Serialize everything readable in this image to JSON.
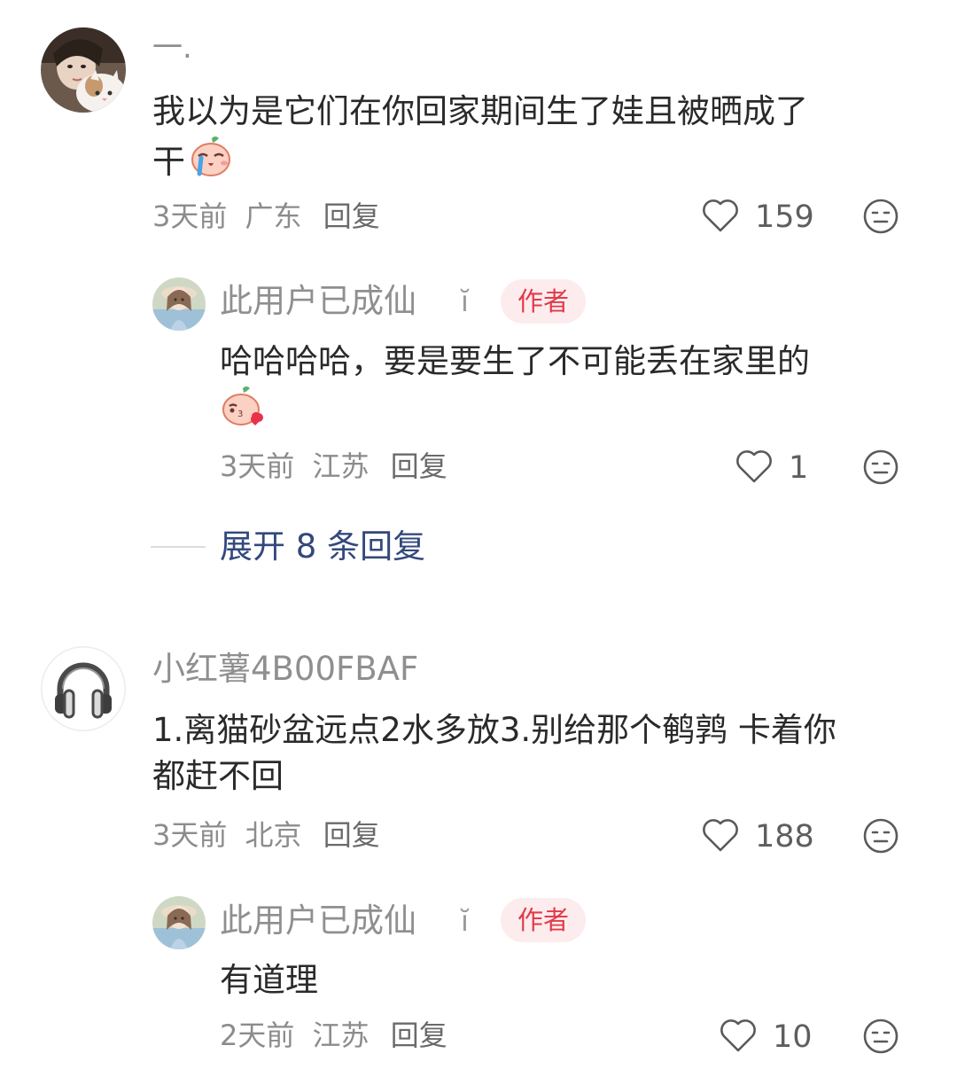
{
  "comments": [
    {
      "username": "一.",
      "text_line1": "我以为是它们在你回家期间生了娃且被晒成了",
      "text_line2": "干",
      "time": "3天前",
      "location": "广东",
      "reply_label": "回复",
      "likes": "159",
      "reply": {
        "username": "此用户已成仙",
        "level_mark": "ĭ",
        "badge": "作者",
        "text_line1": "哈哈哈哈，要是要生了不可能丢在家里的",
        "time": "3天前",
        "location": "江苏",
        "reply_label": "回复",
        "likes": "1"
      },
      "expand_label": "展开 8 条回复"
    },
    {
      "username": "小红薯4B00FBAF",
      "text_line1": "1.离猫砂盆远点2水多放3.别给那个鹌鹑 卡着你",
      "text_line2": "都赶不回",
      "time": "3天前",
      "location": "北京",
      "reply_label": "回复",
      "likes": "188",
      "reply": {
        "username": "此用户已成仙",
        "level_mark": "ĭ",
        "badge": "作者",
        "text_line1": "有道理",
        "time": "2天前",
        "location": "江苏",
        "reply_label": "回复",
        "likes": "10"
      }
    }
  ],
  "icons": {
    "like": "heart-outline-icon",
    "dislike": "meh-face-icon",
    "headphones": "headphones-icon",
    "emoji_crying": "crying-peach-emoji",
    "emoji_kiss": "kissing-peach-emoji"
  },
  "colors": {
    "author_badge_bg": "#fdeced",
    "author_badge_text": "#e23a4b",
    "expand_link": "#33487c"
  }
}
